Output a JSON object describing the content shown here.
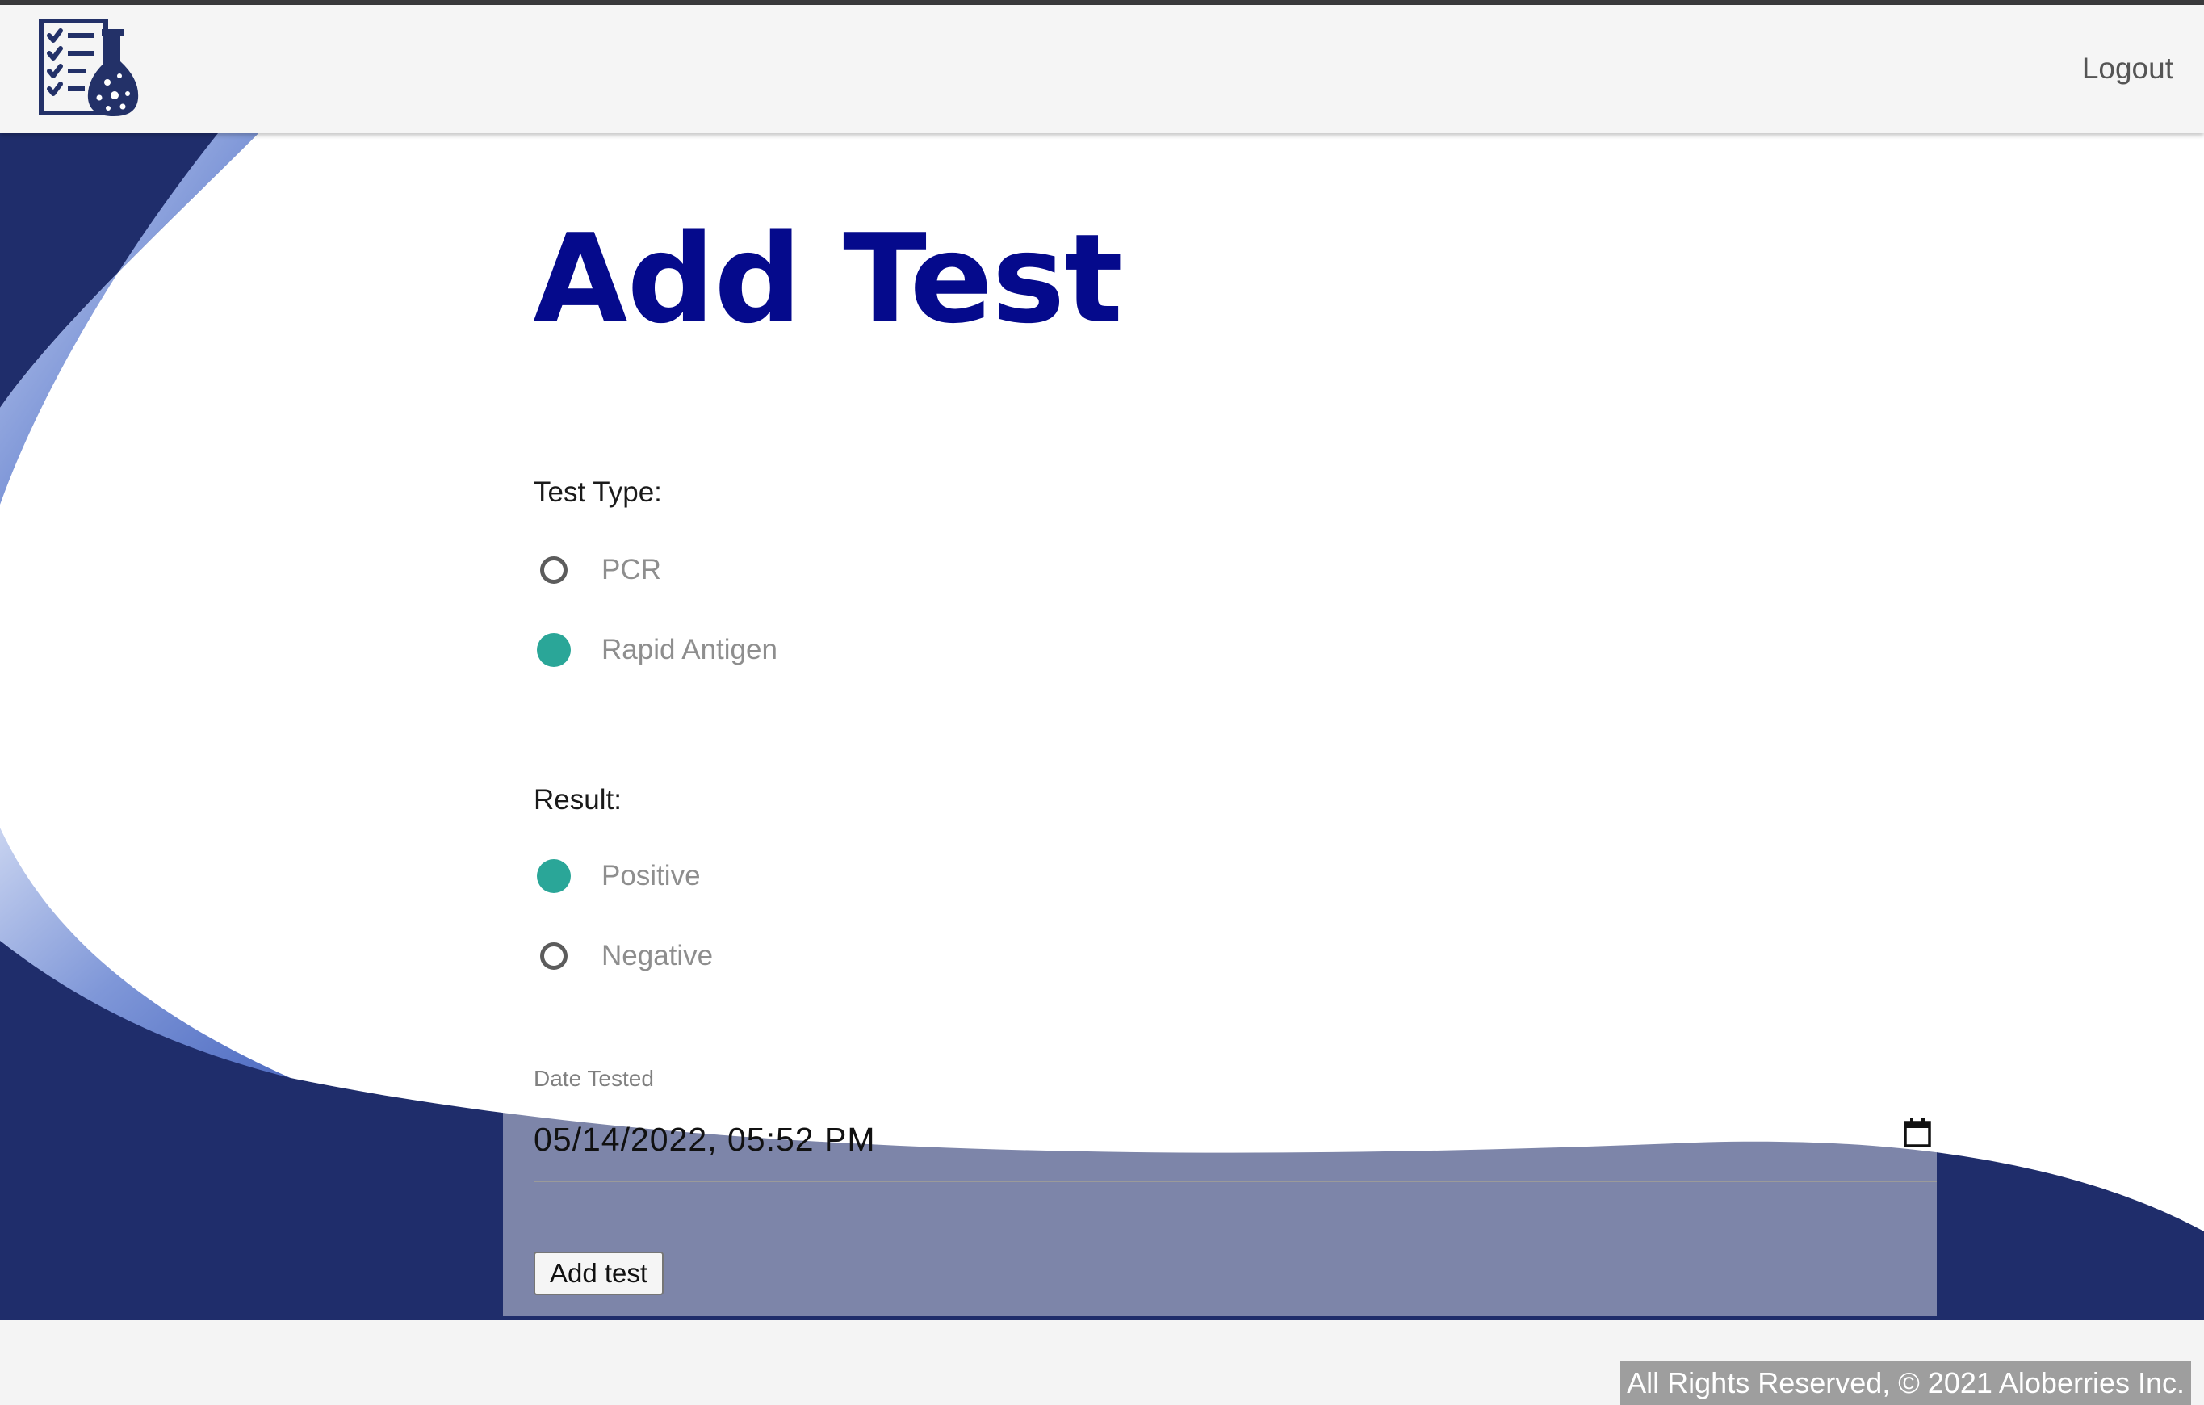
{
  "header": {
    "logo_icon": "checklist-flask-icon",
    "logout_label": "Logout"
  },
  "form": {
    "title": "Add Test",
    "test_type": {
      "label": "Test Type:",
      "options": [
        {
          "label": "PCR",
          "checked": false
        },
        {
          "label": "Rapid Antigen",
          "checked": true
        }
      ]
    },
    "result": {
      "label": "Result:",
      "options": [
        {
          "label": "Positive",
          "checked": true
        },
        {
          "label": "Negative",
          "checked": false
        }
      ]
    },
    "date_tested": {
      "label": "Date Tested",
      "value": "05/14/2022, 05:52 PM",
      "icon": "calendar-icon"
    },
    "submit_label": "Add test"
  },
  "footer": {
    "copyright": "All Rights Reserved, © 2021 Aloberries Inc."
  },
  "colors": {
    "title": "#050a8c",
    "radio_checked": "#2aa698",
    "navy": "#1f2d6b",
    "header_bg": "#f5f5f5"
  }
}
